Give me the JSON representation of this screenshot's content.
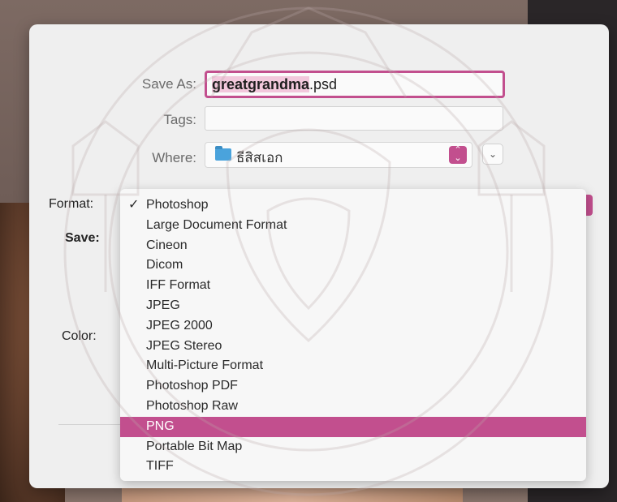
{
  "dialog": {
    "save_as_label": "Save As:",
    "filename_base": "greatgrandma",
    "filename_ext": ".psd",
    "tags_label": "Tags:",
    "tags_value": "",
    "where_label": "Where:",
    "where_value": "ธีสิสเอก",
    "format_label": "Format:",
    "save_label": "Save:",
    "color_label": "Color:",
    "accent_color": "#c24f8e"
  },
  "format_menu": {
    "selected": "PNG",
    "checked": "Photoshop",
    "items": [
      "Photoshop",
      "Large Document Format",
      "Cineon",
      "Dicom",
      "IFF Format",
      "JPEG",
      "JPEG 2000",
      "JPEG Stereo",
      "Multi-Picture Format",
      "Photoshop PDF",
      "Photoshop Raw",
      "PNG",
      "Portable Bit Map",
      "TIFF"
    ],
    "check_mark": "✓"
  },
  "icons": {
    "where_folder": "folder-icon",
    "where_stepper": "up-down-chevron-icon",
    "expand": "chevron-down-icon"
  }
}
